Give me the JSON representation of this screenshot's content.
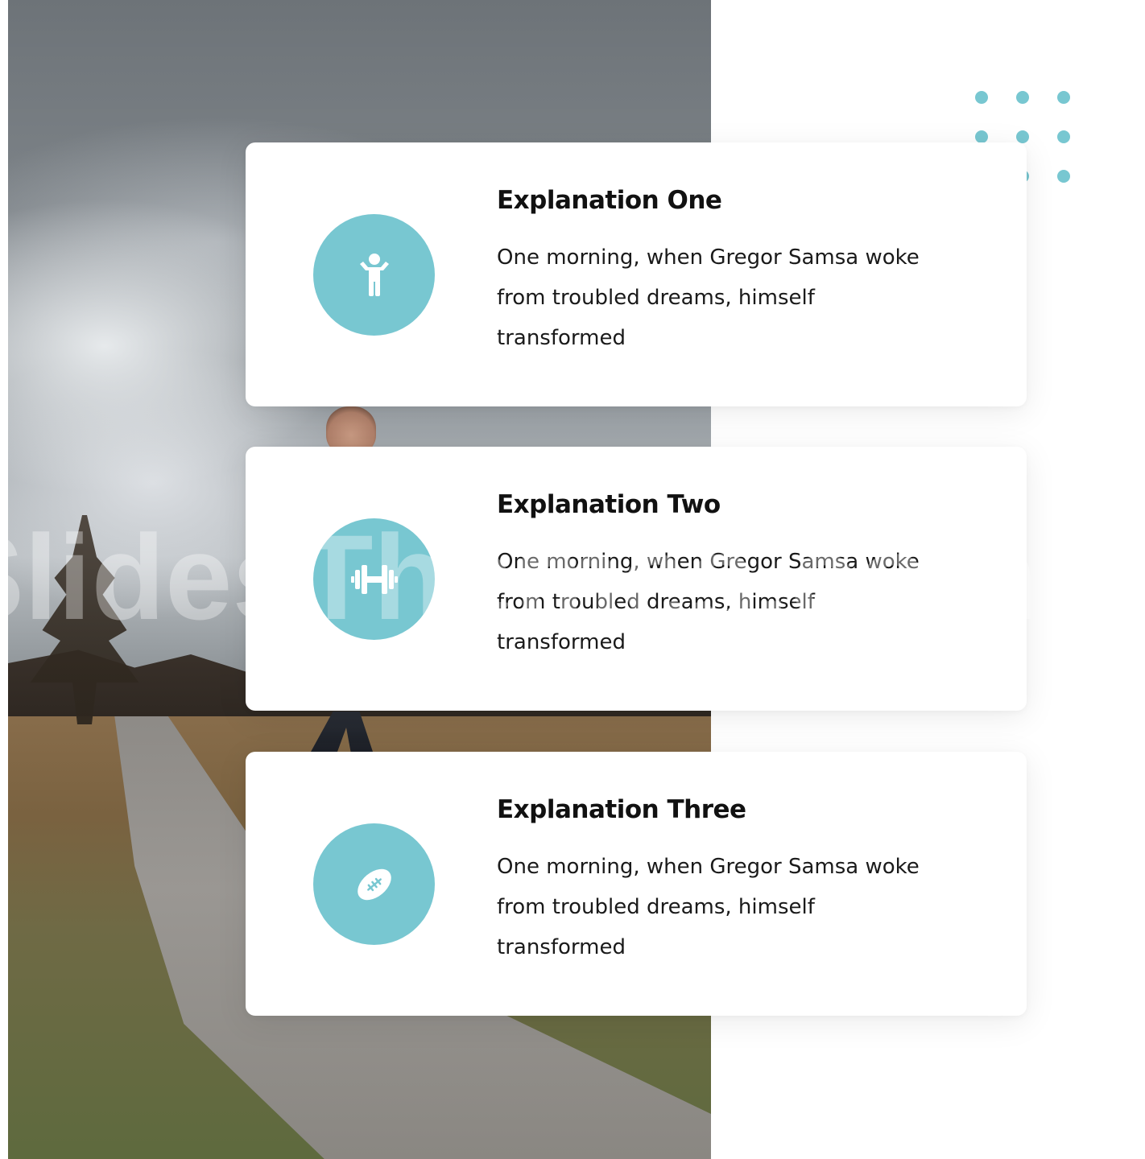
{
  "cards": [
    {
      "title": "Explanation One",
      "body": "One morning, when Gregor Samsa woke from troubled dreams, himself transformed",
      "icon": "child-icon"
    },
    {
      "title": "Explanation Two",
      "body": "One morning, when Gregor Samsa woke from troubled dreams, himself transformed",
      "icon": "dumbbell-icon"
    },
    {
      "title": "Explanation Three",
      "body": "One morning, when Gregor Samsa woke from troubled dreams, himself transformed",
      "icon": "football-icon"
    }
  ],
  "watermark": "SlidesThemes.com",
  "colors": {
    "accent": "#78c7d1",
    "title": "#111111",
    "text": "#1a1a1a",
    "card": "#ffffff"
  }
}
